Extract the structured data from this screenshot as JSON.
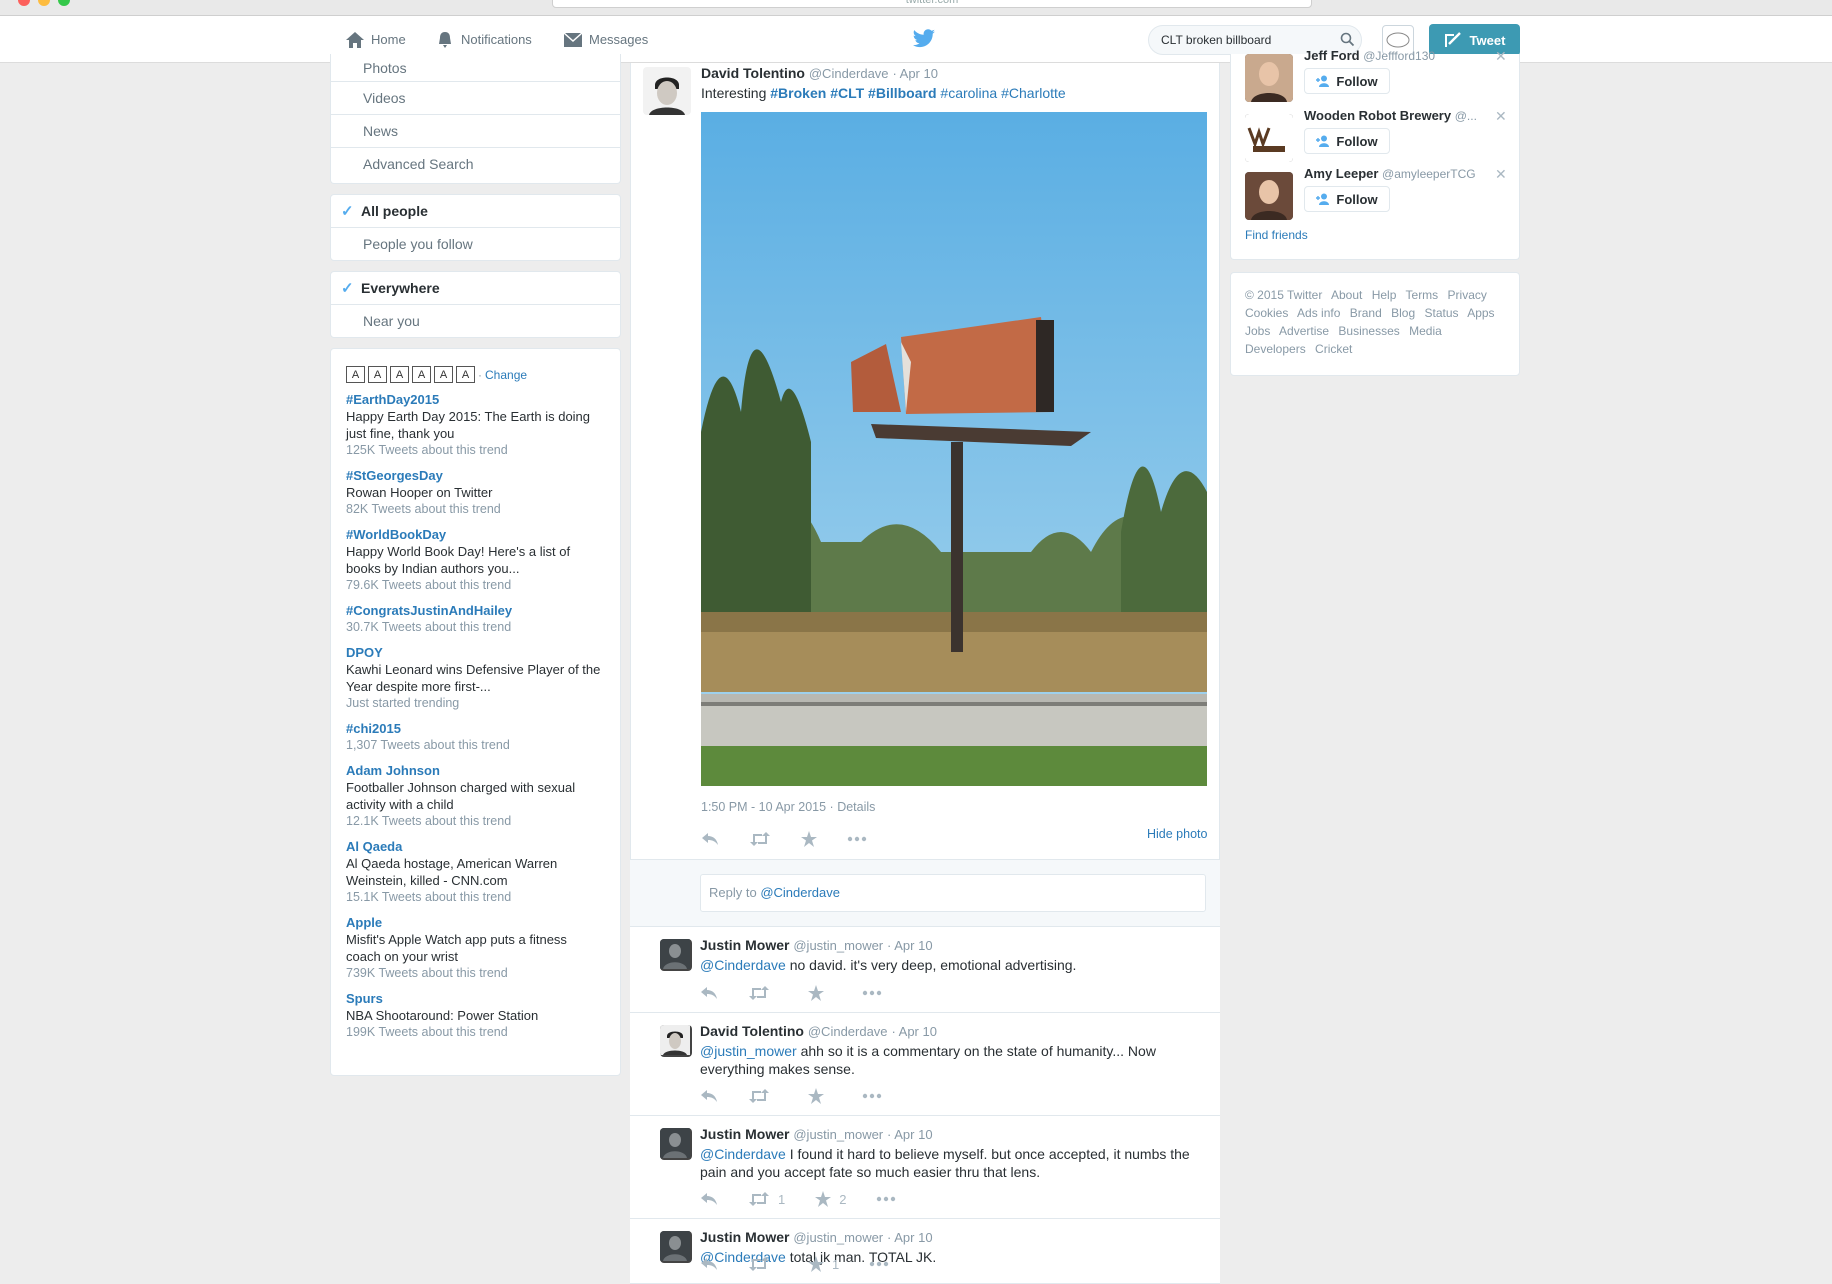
{
  "browser": {
    "url": "twitter.com"
  },
  "topnav": {
    "home": "Home",
    "notifications": "Notifications",
    "messages": "Messages",
    "search_value": "CLT broken billboard",
    "tweet_button": "Tweet"
  },
  "left": {
    "filters1": [
      "Photos",
      "Videos",
      "News",
      "Advanced Search"
    ],
    "people": {
      "selected": "All people",
      "other": "People you follow"
    },
    "places": {
      "selected": "Everywhere",
      "other": "Near you"
    },
    "trends_change": "Change",
    "trends_font_letters": [
      "A",
      "A",
      "A",
      "A",
      "A",
      "A"
    ],
    "trends": [
      {
        "name": "#EarthDay2015",
        "desc": "Happy Earth Day 2015: The Earth is doing just fine, thank you",
        "count": "125K Tweets about this trend"
      },
      {
        "name": "#StGeorgesDay",
        "desc": "Rowan Hooper on Twitter",
        "count": "82K Tweets about this trend"
      },
      {
        "name": "#WorldBookDay",
        "desc": "Happy World Book Day! Here's a list of books by Indian authors you...",
        "count": "79.6K Tweets about this trend"
      },
      {
        "name": "#CongratsJustinAndHailey",
        "desc": "",
        "count": "30.7K Tweets about this trend"
      },
      {
        "name": "DPOY",
        "desc": "Kawhi Leonard wins Defensive Player of the Year despite more first-...",
        "count": "Just started trending"
      },
      {
        "name": "#chi2015",
        "desc": "",
        "count": "1,307 Tweets about this trend"
      },
      {
        "name": "Adam Johnson",
        "desc": "Footballer Johnson charged with sexual activity with a child",
        "count": "12.1K Tweets about this trend"
      },
      {
        "name": "Al Qaeda",
        "desc": "Al Qaeda hostage, American Warren Weinstein, killed - CNN.com",
        "count": "15.1K Tweets about this trend"
      },
      {
        "name": "Apple",
        "desc": "Misfit's Apple Watch app puts a fitness coach on your wrist",
        "count": "739K Tweets about this trend"
      },
      {
        "name": "Spurs",
        "desc": "NBA Shootaround: Power Station",
        "count": "199K Tweets about this trend"
      }
    ]
  },
  "main_tweet": {
    "name": "David Tolentino",
    "handle": "@Cinderdave",
    "date": "· Apr 10",
    "text_prefix": "Interesting ",
    "hashtags": [
      "#Broken",
      "#CLT",
      "#Billboard",
      "#carolina",
      "#Charlotte"
    ],
    "timestamp": "1:50 PM - 10 Apr 2015 · ",
    "details": "Details",
    "hide_photo": "Hide photo"
  },
  "reply": {
    "placeholder_prefix": "Reply to ",
    "placeholder_handle": "@Cinderdave"
  },
  "replies": [
    {
      "name": "Justin Mower",
      "handle": "@justin_mower",
      "date": "· Apr 10",
      "mention": "@Cinderdave",
      "text": " no david. it's very deep, emotional advertising.",
      "retweets": "",
      "favorites": ""
    },
    {
      "name": "David Tolentino",
      "handle": "@Cinderdave",
      "date": "· Apr 10",
      "mention": "@justin_mower",
      "text": " ahh so it is a commentary on the state of humanity... Now everything makes sense.",
      "retweets": "",
      "favorites": ""
    },
    {
      "name": "Justin Mower",
      "handle": "@justin_mower",
      "date": "· Apr 10",
      "mention": "@Cinderdave",
      "text": " I found it hard to believe myself. but once accepted, it numbs the pain and you accept fate so much easier thru that lens.",
      "retweets": "1",
      "favorites": "2"
    },
    {
      "name": "Justin Mower",
      "handle": "@justin_mower",
      "date": "· Apr 10",
      "mention": "@Cinderdave",
      "text": " total jk man. TOTAL JK.",
      "retweets": "",
      "favorites": "1"
    }
  ],
  "right": {
    "who_to_follow": [
      {
        "name": "Jeff Ford",
        "handle": "@Jeffford130"
      },
      {
        "name": "Wooden Robot Brewery",
        "handle": "@..."
      },
      {
        "name": "Amy Leeper",
        "handle": "@amyleeperTCG"
      }
    ],
    "follow_label": "Follow",
    "find_friends": "Find friends",
    "footer": [
      "© 2015 Twitter",
      "About",
      "Help",
      "Terms",
      "Privacy",
      "Cookies",
      "Ads info",
      "Brand",
      "Blog",
      "Status",
      "Apps",
      "Jobs",
      "Advertise",
      "Businesses",
      "Media",
      "Developers",
      "Cricket"
    ]
  },
  "colors": {
    "link": "#2b7bb9",
    "tweet_button": "#3d9ab3",
    "muted": "#8899a6"
  }
}
